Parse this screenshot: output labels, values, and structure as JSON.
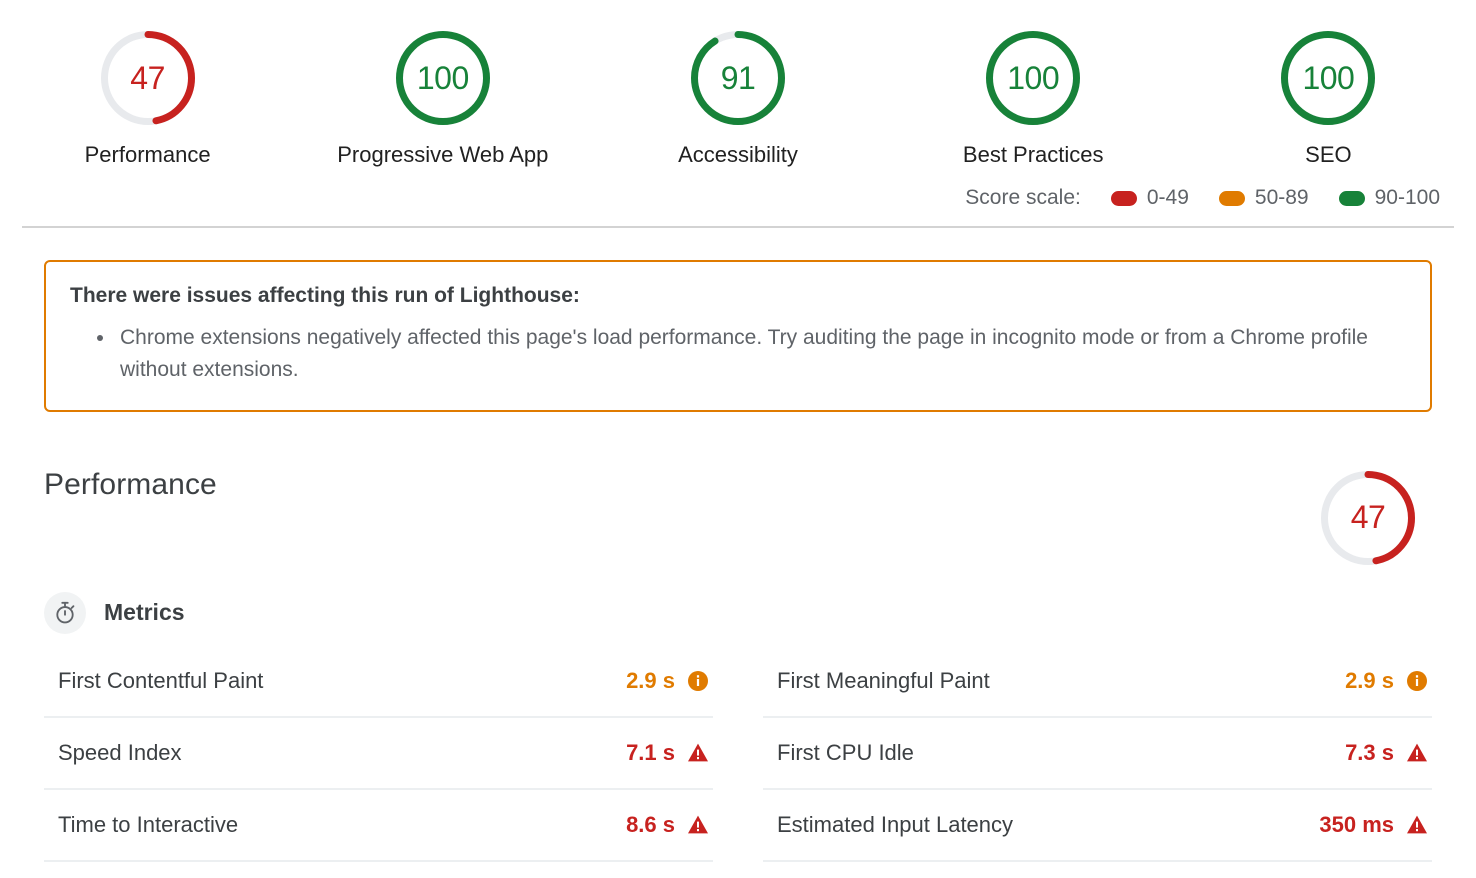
{
  "colors": {
    "red": "#C7221F",
    "orange": "#E07B00",
    "green": "#178239",
    "track": "#E8EAED",
    "divider": "#d3d3d3"
  },
  "category_scores": [
    {
      "label": "Performance",
      "score": "47",
      "value": 47,
      "rating": "fail"
    },
    {
      "label": "Progressive Web App",
      "score": "100",
      "value": 100,
      "rating": "pass"
    },
    {
      "label": "Accessibility",
      "score": "91",
      "value": 91,
      "rating": "pass"
    },
    {
      "label": "Best Practices",
      "score": "100",
      "value": 100,
      "rating": "pass"
    },
    {
      "label": "SEO",
      "score": "100",
      "value": 100,
      "rating": "pass"
    }
  ],
  "score_scale": {
    "title": "Score scale:",
    "items": [
      {
        "range": "0-49",
        "color": "#C7221F"
      },
      {
        "range": "50-89",
        "color": "#E07B00"
      },
      {
        "range": "90-100",
        "color": "#178239"
      }
    ]
  },
  "warning": {
    "title": "There were issues affecting this run of Lighthouse:",
    "items": [
      "Chrome extensions negatively affected this page's load performance. Try auditing the page in incognito mode or from a Chrome profile without extensions."
    ]
  },
  "performance_section": {
    "title": "Performance",
    "score": "47",
    "score_value": 47,
    "metrics_heading": "Metrics",
    "metrics_icon": "stopwatch-icon",
    "metrics": [
      {
        "name": "First Contentful Paint",
        "value": "2.9 s",
        "rating": "average",
        "badge": "info-icon"
      },
      {
        "name": "First Meaningful Paint",
        "value": "2.9 s",
        "rating": "average",
        "badge": "info-icon"
      },
      {
        "name": "Speed Index",
        "value": "7.1 s",
        "rating": "fail",
        "badge": "warning-triangle-icon"
      },
      {
        "name": "First CPU Idle",
        "value": "7.3 s",
        "rating": "fail",
        "badge": "warning-triangle-icon"
      },
      {
        "name": "Time to Interactive",
        "value": "8.6 s",
        "rating": "fail",
        "badge": "warning-triangle-icon"
      },
      {
        "name": "Estimated Input Latency",
        "value": "350 ms",
        "rating": "fail",
        "badge": "warning-triangle-icon"
      }
    ]
  }
}
